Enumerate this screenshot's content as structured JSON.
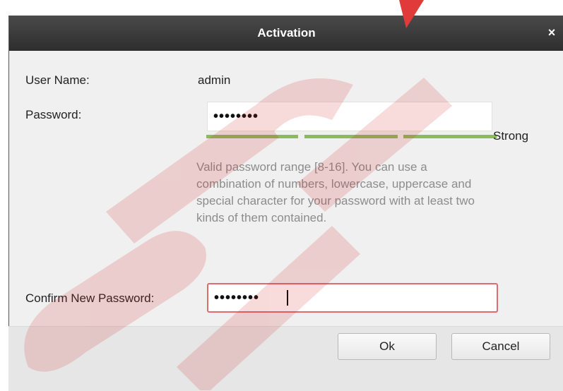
{
  "dialog": {
    "title": "Activation",
    "close_glyph": "×"
  },
  "form": {
    "username_label": "User Name:",
    "username_value": "admin",
    "password_label": "Password:",
    "password_value": "••••••••",
    "strength_label": "Strong",
    "strength_level": 3,
    "strength_levels_total": 3,
    "hint_text": "Valid password range [8-16]. You can use a combination of numbers, lowercase, uppercase and special character for your password with at least two kinds of them contained.",
    "confirm_label": "Confirm New Password:",
    "confirm_value": "••••••••"
  },
  "buttons": {
    "ok": "Ok",
    "cancel": "Cancel"
  },
  "colors": {
    "strength": "#8dbb5b",
    "error_border": "#e06b6b",
    "watermark": "#d31f1f"
  },
  "icons": {
    "close": "close-icon"
  }
}
